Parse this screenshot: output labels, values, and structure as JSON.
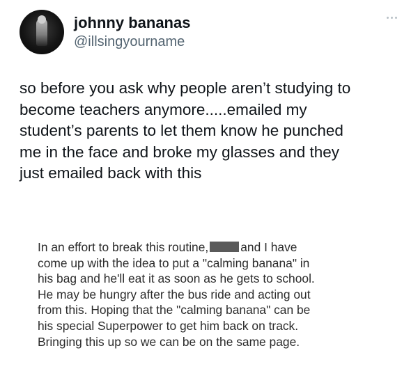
{
  "post": {
    "author": {
      "display_name": "johnny bananas",
      "handle": "@illsingyourname",
      "avatar_icon": "profile-photo"
    },
    "more_icon": "more-options-icon",
    "text": "so before you ask why people aren’t studying to\nbecome teachers anymore.....emailed my\nstudent’s parents to let them know he punched\nme in the face and broke my glasses and they\njust emailed back with this",
    "quoted_email": {
      "line1_before": "In an effort to break this routine,",
      "line1_after": "and I have",
      "lines": [
        "come up with the idea to put a \"calming banana\" in",
        "his bag and he'll eat it as soon as he gets to school.",
        "He may be hungry after the bus ride and acting out",
        "from this. Hoping that the \"calming banana\" can be",
        "his special Superpower to get him back on track.",
        "Bringing this up so we can be on the same page."
      ]
    }
  }
}
